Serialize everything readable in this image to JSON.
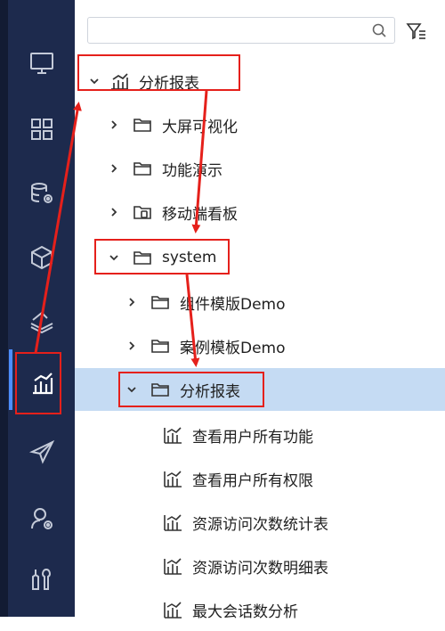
{
  "search": {
    "placeholder": "",
    "value": ""
  },
  "rail": {
    "items": [
      {
        "icon": "monitor-icon"
      },
      {
        "icon": "grid-icon"
      },
      {
        "icon": "database-gear-icon"
      },
      {
        "icon": "cube-icon"
      },
      {
        "icon": "layers-icon"
      },
      {
        "icon": "bar-chart-icon",
        "active": true
      },
      {
        "icon": "send-icon"
      },
      {
        "icon": "user-gear-icon"
      },
      {
        "icon": "tools-icon"
      }
    ]
  },
  "tree": {
    "root": "分析报表",
    "folders": [
      "大屏可视化",
      "功能演示",
      "移动端看板"
    ],
    "system": "system",
    "system_children": [
      "组件模版Demo",
      "案例模板Demo"
    ],
    "selected_folder": "分析报表",
    "reports": [
      "查看用户所有功能",
      "查看用户所有权限",
      "资源访问次数统计表",
      "资源访问次数明细表",
      "最大会话数分析"
    ]
  },
  "colors": {
    "rail": "#1d2a4d",
    "selected_row": "#c5dbf3",
    "annotation": "#e5201b"
  }
}
